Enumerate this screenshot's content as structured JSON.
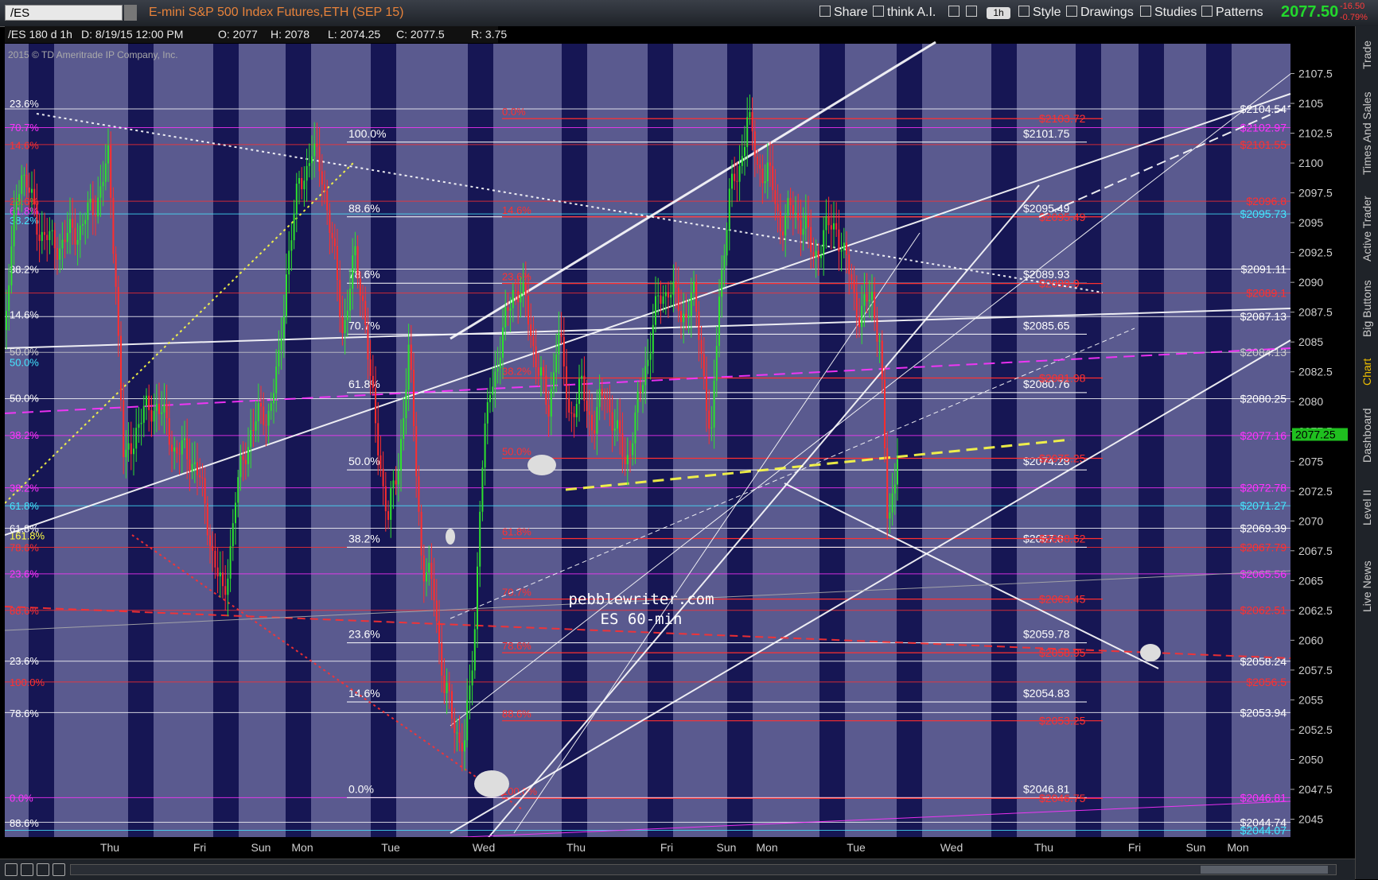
{
  "toolbar": {
    "symbol": "/ES",
    "title": "E-mini S&P 500 Index Futures,ETH (SEP 15)",
    "share": "Share",
    "think": "think A.I.",
    "timeframe": "1h",
    "style": "Style",
    "drawings": "Drawings",
    "studies": "Studies",
    "patterns": "Patterns",
    "last_price": "2077.50",
    "change": "-16.50",
    "change_pct": "-0.79%"
  },
  "sidebar": [
    "Trade",
    "Times And Sales",
    "Active Trader",
    "Big Buttons",
    "Chart",
    "Dashboard",
    "Level II",
    "Live News"
  ],
  "colors": {
    "background": "#5a5a8f",
    "shade_band": "#0b0b4a",
    "up_candle": "#2ee02e",
    "down_candle": "#ff2d2d",
    "white_line": "#ffffff",
    "magenta": "#ff33ff",
    "red": "#ff3030",
    "cyan": "#44e6ff",
    "yellow": "#ffff44"
  },
  "chart_data": {
    "type": "candlestick",
    "symbol": "/ES",
    "aggregation": "180 d 1h",
    "header": {
      "label": "/ES 180 d 1h",
      "date": "D: 8/19/15 12:00 PM",
      "open": "O: 2077",
      "high": "H: 2078",
      "low": "L: 2074.25",
      "close": "C: 2077.5",
      "range": "R: 3.75"
    },
    "copyright": "2015 © TD Ameritrade IP Company, Inc.",
    "watermark": [
      "pebblewriter.com",
      "ES 60-min"
    ],
    "ylim": [
      2043.5,
      2110.0
    ],
    "y_ticks": [
      2045,
      2047.5,
      2050,
      2052.5,
      2055,
      2057.5,
      2060,
      2062.5,
      2065,
      2067.5,
      2070,
      2072.5,
      2075,
      2077.5,
      2080,
      2082.5,
      2085,
      2087.5,
      2090,
      2092.5,
      2095,
      2097.5,
      2100,
      2102.5,
      2105,
      2107.5
    ],
    "x_labels": [
      "Thu",
      "Fri",
      "Sun",
      "Mon",
      "Tue",
      "Wed",
      "Thu",
      "Fri",
      "Sun",
      "Mon",
      "Tue",
      "Wed",
      "Thu",
      "Fri",
      "Sun",
      "Mon"
    ],
    "current_price": 2077.25,
    "close_path": [
      [
        0,
        2086
      ],
      [
        12,
        2095
      ],
      [
        20,
        2100
      ],
      [
        28,
        2098
      ],
      [
        40,
        2095
      ],
      [
        60,
        2093
      ],
      [
        85,
        2094
      ],
      [
        110,
        2096
      ],
      [
        130,
        2100
      ],
      [
        140,
        2090
      ],
      [
        150,
        2074
      ],
      [
        165,
        2078
      ],
      [
        190,
        2080
      ],
      [
        215,
        2076
      ],
      [
        240,
        2075
      ],
      [
        260,
        2068
      ],
      [
        275,
        2063
      ],
      [
        290,
        2072
      ],
      [
        310,
        2078
      ],
      [
        330,
        2079
      ],
      [
        345,
        2083
      ],
      [
        355,
        2092
      ],
      [
        370,
        2098
      ],
      [
        385,
        2101
      ],
      [
        400,
        2099
      ],
      [
        410,
        2094
      ],
      [
        425,
        2086
      ],
      [
        440,
        2092
      ],
      [
        452,
        2088
      ],
      [
        460,
        2081
      ],
      [
        470,
        2076
      ],
      [
        482,
        2070
      ],
      [
        495,
        2075
      ],
      [
        508,
        2084
      ],
      [
        515,
        2077
      ],
      [
        525,
        2066
      ],
      [
        540,
        2064
      ],
      [
        552,
        2056
      ],
      [
        565,
        2053
      ],
      [
        578,
        2051
      ],
      [
        590,
        2060
      ],
      [
        598,
        2073
      ],
      [
        610,
        2081
      ],
      [
        625,
        2085
      ],
      [
        640,
        2090
      ],
      [
        655,
        2088
      ],
      [
        670,
        2083
      ],
      [
        683,
        2079
      ],
      [
        695,
        2086
      ],
      [
        710,
        2079
      ],
      [
        725,
        2081
      ],
      [
        740,
        2078
      ],
      [
        755,
        2081
      ],
      [
        770,
        2077
      ],
      [
        780,
        2075
      ],
      [
        792,
        2078
      ],
      [
        805,
        2083
      ],
      [
        820,
        2088
      ],
      [
        835,
        2090
      ],
      [
        850,
        2087
      ],
      [
        865,
        2089
      ],
      [
        880,
        2082
      ],
      [
        888,
        2076
      ],
      [
        898,
        2089
      ],
      [
        910,
        2097
      ],
      [
        922,
        2099
      ],
      [
        933,
        2104
      ],
      [
        945,
        2100
      ],
      [
        960,
        2099
      ],
      [
        975,
        2095
      ],
      [
        990,
        2096
      ],
      [
        1005,
        2095
      ],
      [
        1015,
        2092
      ],
      [
        1030,
        2094
      ],
      [
        1045,
        2095
      ],
      [
        1055,
        2092
      ],
      [
        1065,
        2090
      ],
      [
        1075,
        2087
      ],
      [
        1090,
        2089
      ],
      [
        1100,
        2085
      ],
      [
        1105,
        2077
      ],
      [
        1110,
        2069
      ],
      [
        1118,
        2074
      ],
      [
        1125,
        2077.5
      ]
    ],
    "right_axis_labels": [
      {
        "text": "$2104.54",
        "y": 2104.54,
        "color": "#ffffff"
      },
      {
        "text": "$2102.97",
        "y": 2102.97,
        "color": "#ff33ff"
      },
      {
        "text": "$2101.55",
        "y": 2101.55,
        "color": "#ff3030"
      },
      {
        "text": "$2096.8",
        "y": 2096.8,
        "color": "#ff3030"
      },
      {
        "text": "$2095.73",
        "y": 2095.73,
        "color": "#44e6ff"
      },
      {
        "text": "$2091.11",
        "y": 2091.11,
        "color": "#ffffff"
      },
      {
        "text": "$2089.1",
        "y": 2089.1,
        "color": "#ff3030"
      },
      {
        "text": "$2087.13",
        "y": 2087.13,
        "color": "#ffffff"
      },
      {
        "text": "$2084.13",
        "y": 2084.13,
        "color": "#cccccc"
      },
      {
        "text": "$2080.25",
        "y": 2080.25,
        "color": "#ffffff"
      },
      {
        "text": "$2077.16",
        "y": 2077.16,
        "color": "#ff33ff"
      },
      {
        "text": "$2072.78",
        "y": 2072.78,
        "color": "#ff33ff"
      },
      {
        "text": "$2071.27",
        "y": 2071.27,
        "color": "#44e6ff"
      },
      {
        "text": "$2069.39",
        "y": 2069.39,
        "color": "#ffffff"
      },
      {
        "text": "$2067.79",
        "y": 2067.79,
        "color": "#ff3030"
      },
      {
        "text": "$2065.56",
        "y": 2065.56,
        "color": "#ff33ff"
      },
      {
        "text": "$2062.51",
        "y": 2062.51,
        "color": "#ff3030"
      },
      {
        "text": "$2058.24",
        "y": 2058.24,
        "color": "#ffffff"
      },
      {
        "text": "$2056.5",
        "y": 2056.5,
        "color": "#ff3030"
      },
      {
        "text": "$2053.94",
        "y": 2053.94,
        "color": "#ffffff"
      },
      {
        "text": "$2046.81",
        "y": 2046.81,
        "color": "#ff33ff"
      },
      {
        "text": "$2044.74",
        "y": 2044.74,
        "color": "#ffffff"
      },
      {
        "text": "$2044.07",
        "y": 2044.07,
        "color": "#44e6ff"
      }
    ],
    "fib_white": [
      {
        "label": "100.0%",
        "y": 2101.75,
        "price": "$2101.75"
      },
      {
        "label": "88.6%",
        "y": 2095.49,
        "price": "$2095.49"
      },
      {
        "label": "78.6%",
        "y": 2089.93,
        "price": "$2089.93"
      },
      {
        "label": "70.7%",
        "y": 2085.65,
        "price": "$2085.65"
      },
      {
        "label": "61.8%",
        "y": 2080.76,
        "price": "$2080.76"
      },
      {
        "label": "50.0%",
        "y": 2074.28,
        "price": "$2074.28"
      },
      {
        "label": "38.2%",
        "y": 2067.8,
        "price": "$2067.8"
      },
      {
        "label": "23.6%",
        "y": 2059.78,
        "price": "$2059.78"
      },
      {
        "label": "14.6%",
        "y": 2054.83,
        "price": "$2054.83"
      },
      {
        "label": "0.0%",
        "y": 2046.81,
        "price": "$2046.81"
      }
    ],
    "fib_red": [
      {
        "label": "0.0%",
        "y": 2103.72,
        "price": "$2103.72"
      },
      {
        "label": "14.6%",
        "y": 2095.49,
        "price": "$2095.49"
      },
      {
        "label": "23.6%",
        "y": 2089.9,
        "price": "$2089.9"
      },
      {
        "label": "38.2%",
        "y": 2081.98,
        "price": "$2081.98"
      },
      {
        "label": "50.0%",
        "y": 2075.25,
        "price": "$2075.25"
      },
      {
        "label": "61.8%",
        "y": 2068.52,
        "price": "$2068.52"
      },
      {
        "label": "70.7%",
        "y": 2063.45,
        "price": "$2063.45"
      },
      {
        "label": "78.6%",
        "y": 2058.95,
        "price": "$2058.95"
      },
      {
        "label": "88.6%",
        "y": 2053.25,
        "price": "$2053.25"
      },
      {
        "label": "100.0%",
        "y": 2046.75,
        "price": "$2046.75"
      }
    ],
    "left_fibs": [
      {
        "label": "23.6%",
        "y": 2105,
        "color": "#ffffff"
      },
      {
        "label": "70.7%",
        "y": 2103,
        "color": "#ff33ff"
      },
      {
        "label": "14.6%",
        "y": 2101.5,
        "color": "#ff3030"
      },
      {
        "label": "23.6%",
        "y": 2096.8,
        "color": "#ff3030"
      },
      {
        "label": "61.8%",
        "y": 2096,
        "color": "#ff33ff"
      },
      {
        "label": "38.2%",
        "y": 2095.2,
        "color": "#44e6ff"
      },
      {
        "label": "38.2%",
        "y": 2091.1,
        "color": "#ffffff"
      },
      {
        "label": "14.6%",
        "y": 2087.3,
        "color": "#ffffff"
      },
      {
        "label": "50.0%",
        "y": 2084.2,
        "color": "#cccccc"
      },
      {
        "label": "50.0%",
        "y": 2083.3,
        "color": "#44e6ff"
      },
      {
        "label": "50.0%",
        "y": 2080.3,
        "color": "#ffffff"
      },
      {
        "label": "38.2%",
        "y": 2077.2,
        "color": "#ff33ff"
      },
      {
        "label": "38.2%",
        "y": 2072.8,
        "color": "#ff33ff"
      },
      {
        "label": "61.8%",
        "y": 2071.3,
        "color": "#44e6ff"
      },
      {
        "label": "61.8%",
        "y": 2069.4,
        "color": "#ffffff"
      },
      {
        "label": "161.8%",
        "y": 2068.8,
        "color": "#ffff44"
      },
      {
        "label": "78.6%",
        "y": 2067.8,
        "color": "#ff3030"
      },
      {
        "label": "23.6%",
        "y": 2065.6,
        "color": "#ff33ff"
      },
      {
        "label": "88.6%",
        "y": 2062.5,
        "color": "#ff3030"
      },
      {
        "label": "23.6%",
        "y": 2058.3,
        "color": "#ffffff"
      },
      {
        "label": "100.0%",
        "y": 2056.5,
        "color": "#ff3030"
      },
      {
        "label": "78.6%",
        "y": 2053.9,
        "color": "#ffffff"
      },
      {
        "label": "0.0%",
        "y": 2046.8,
        "color": "#ff33ff"
      },
      {
        "label": "88.6%",
        "y": 2044.7,
        "color": "#ffffff"
      }
    ]
  }
}
